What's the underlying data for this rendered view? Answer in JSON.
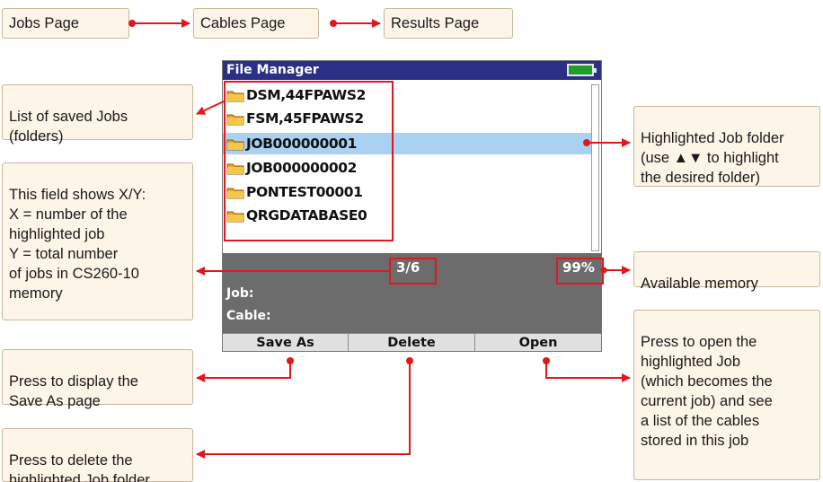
{
  "nav": {
    "jobs": "Jobs Page",
    "cables": "Cables Page",
    "results": "Results Page"
  },
  "screen": {
    "title": "File Manager",
    "folders": [
      "DSM,44FPAWS2",
      "FSM,45FPAWS2",
      "JOB000000001",
      "JOB000000002",
      "PONTEST00001",
      "QRGDATABASE0"
    ],
    "selected_index": 2,
    "count": "3/6",
    "memory": "99%",
    "job_label": "Job:",
    "cable_label": "Cable:",
    "softkeys": {
      "save_as": "Save As",
      "delete": "Delete",
      "open": "Open"
    }
  },
  "callouts": {
    "saved_jobs": "List of saved Jobs\n(folders)",
    "field_xy": "This field shows X/Y:\nX = number of the\nhighlighted job\nY = total number\nof jobs in CS260-10\nmemory",
    "highlighted": "Highlighted Job folder\n(use ▲▼ to highlight\nthe desired folder)",
    "memory": "Available memory",
    "save_as": "Press to display the\nSave As page",
    "delete": "Press to delete the\nhighlighted Job folder",
    "open": "Press to open the\nhighlighted Job\n(which becomes the\ncurrent job) and see\na list of the cables\nstored in this job"
  },
  "colors": {
    "accent_red": "#e3161b",
    "title_bar": "#2b2f86",
    "selection": "#a9d1f2",
    "status_bg": "#6c6c6c",
    "callout_bg": "#fdf5e8",
    "battery": "#1e9e2c"
  }
}
